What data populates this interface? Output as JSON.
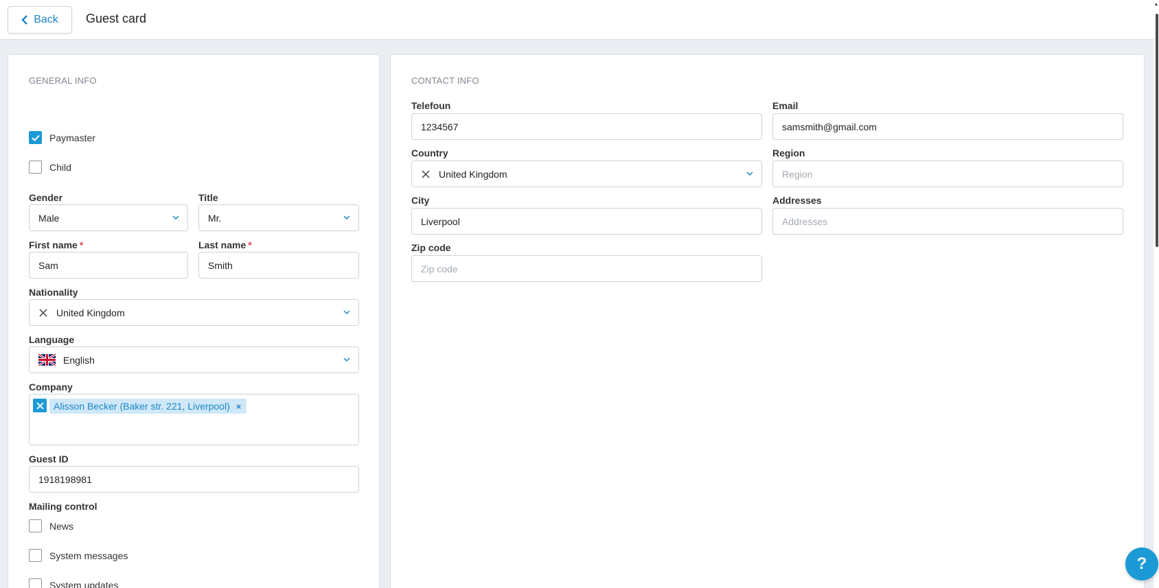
{
  "header": {
    "back_label": "Back",
    "title": "Guest card"
  },
  "general": {
    "section_title": "GENERAL INFO",
    "paymaster_label": "Paymaster",
    "paymaster_checked": true,
    "child_label": "Child",
    "child_checked": false,
    "gender": {
      "label": "Gender",
      "value": "Male"
    },
    "title": {
      "label": "Title",
      "value": "Mr."
    },
    "first_name": {
      "label": "First name",
      "required_mark": "*",
      "value": "Sam"
    },
    "last_name": {
      "label": "Last name",
      "required_mark": "*",
      "value": "Smith"
    },
    "nationality": {
      "label": "Nationality",
      "value": "United Kingdom"
    },
    "language": {
      "label": "Language",
      "value": "English",
      "flag_icon": "uk-flag-icon"
    },
    "company": {
      "label": "Company",
      "tag": "Alisson Becker (Baker str. 221, Liverpool)",
      "tag_remove": "×"
    },
    "guest_id": {
      "label": "Guest ID",
      "value": "1918198981"
    },
    "mailing": {
      "label": "Mailing control",
      "options": [
        {
          "label": "News",
          "checked": false
        },
        {
          "label": "System messages",
          "checked": false
        },
        {
          "label": "System updates",
          "checked": false
        }
      ]
    }
  },
  "contact": {
    "section_title": "CONTACT INFO",
    "phone": {
      "label": "Telefoun",
      "value": "1234567"
    },
    "email": {
      "label": "Email",
      "value": "samsmith@gmail.com"
    },
    "country": {
      "label": "Country",
      "value": "United Kingdom"
    },
    "region": {
      "label": "Region",
      "placeholder": "Region"
    },
    "city": {
      "label": "City",
      "value": "Liverpool"
    },
    "addresses": {
      "label": "Addresses",
      "placeholder": "Addresses"
    },
    "zip": {
      "label": "Zip code",
      "placeholder": "Zip code"
    }
  },
  "help": {
    "label": "?"
  },
  "colors": {
    "accent": "#1c9ad6",
    "link": "#1c86c8",
    "required": "#e24b4b",
    "background": "#eaedf1"
  }
}
